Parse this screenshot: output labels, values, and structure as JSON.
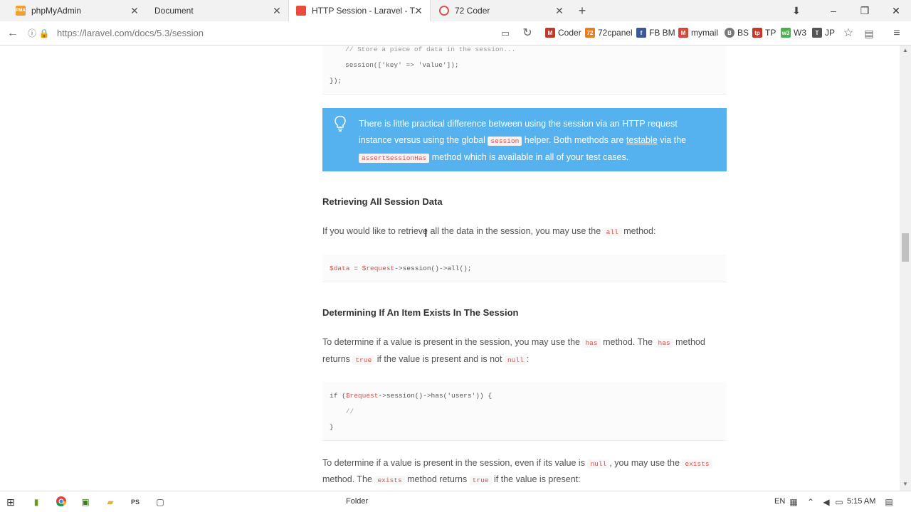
{
  "browser": {
    "tabs": [
      {
        "title": "phpMyAdmin",
        "favicon_text": "PMA",
        "favicon_color": "#f0a030",
        "active": false
      },
      {
        "title": "Document",
        "favicon_text": "",
        "favicon_color": "#f2f2f2",
        "active": false
      },
      {
        "title": "HTTP Session - Laravel - T...",
        "favicon_text": "",
        "favicon_color": "#e74c3c",
        "active": true
      },
      {
        "title": "72 Coder",
        "favicon_text": "",
        "favicon_color": "#d9534f",
        "active": false
      }
    ],
    "new_tab_icon": "plus-icon",
    "url": "https://laravel.com/docs/5.3/session",
    "bookmarks": [
      {
        "label": "Coder",
        "color": "#c0392b",
        "text": "M"
      },
      {
        "label": "72cpanel",
        "color": "#e67e22",
        "text": "72"
      },
      {
        "label": "FB BM",
        "color": "#3b5998",
        "text": "f"
      },
      {
        "label": "mymail",
        "color": "#d44638",
        "text": "M"
      },
      {
        "label": "BS",
        "color": "#777777",
        "text": "B"
      },
      {
        "label": "TP",
        "color": "#c0392b",
        "text": "tp"
      },
      {
        "label": "W3",
        "color": "#4caf50",
        "text": "w3"
      },
      {
        "label": "JP",
        "color": "#555555",
        "text": "T"
      }
    ]
  },
  "page": {
    "code1": {
      "comment": "// Store a piece of data in the session...",
      "line": "session(['key' => 'value']);",
      "close": "});"
    },
    "note": {
      "l1": "There is little practical difference between using the session via an HTTP request",
      "l2a": "instance versus using the global",
      "l2code": "session",
      "l2b": "helper. Both methods are",
      "l2link": "testable",
      "l2c": "via the",
      "l3code": "assertSessionHas",
      "l3b": "method which is available in all of your test cases."
    },
    "h_all": "Retrieving All Session Data",
    "p_all_a": "If you would like to retrieve all the data in the session, you may use the",
    "p_all_code": "all",
    "p_all_b": "method:",
    "code2": {
      "var1": "$data",
      "eq": " = ",
      "var2": "$request",
      "rest": "->session()->all();"
    },
    "h_exists": "Determining If An Item Exists In The Session",
    "p_has1_a": "To determine if a value is present in the session, you may use the",
    "p_has1_code": "has",
    "p_has1_b": "method. The",
    "p_has1_code2": "has",
    "p_has1_c": "method",
    "p_has2_a": "returns",
    "p_has2_code": "true",
    "p_has2_b": "if the value is present and is not",
    "p_has2_code2": "null",
    "p_has2_c": ":",
    "code3": {
      "if": "if (",
      "var": "$request",
      "rest": "->session()->has('users')) {",
      "comment": "    //",
      "close": "}"
    },
    "p_ex1_a": "To determine if a value is present in the session, even if its value is",
    "p_ex1_code": "null",
    "p_ex1_b": ", you may use the",
    "p_ex1_code2": "exists",
    "p_ex2_a": "method. The",
    "p_ex2_code": "exists",
    "p_ex2_b": "method returns",
    "p_ex2_code2": "true",
    "p_ex2_c": "if the value is present:"
  },
  "taskbar": {
    "folder_label": "Folder",
    "lang": "EN",
    "time": "5:15 AM"
  }
}
